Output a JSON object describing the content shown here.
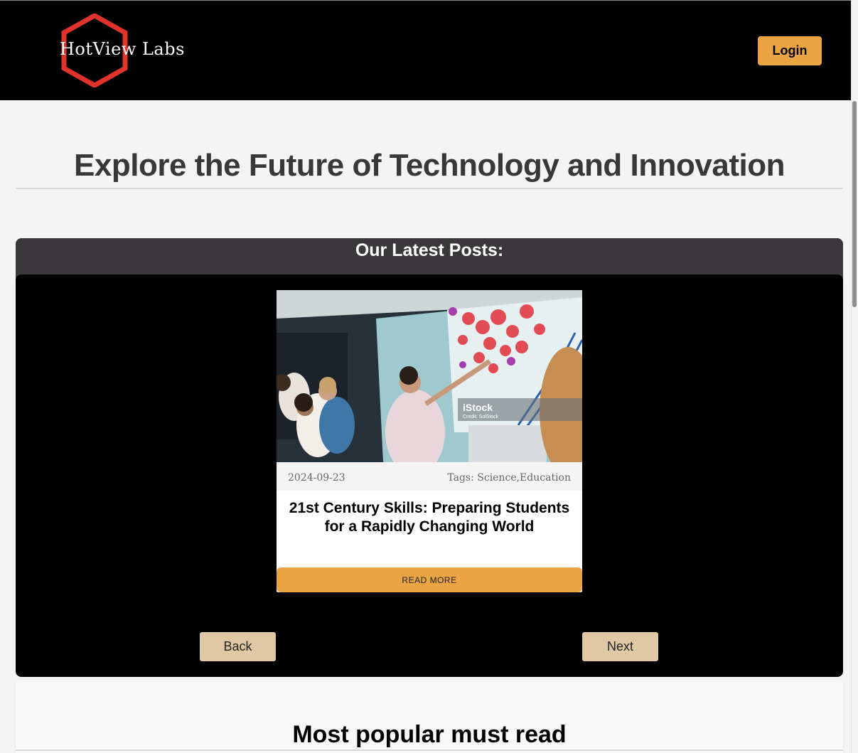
{
  "header": {
    "logo_text": "HotView Labs",
    "login_label": "Login"
  },
  "hero": {
    "title": "Explore the Future of Technology and Innovation"
  },
  "latest": {
    "title": "Our Latest Posts:",
    "post": {
      "date": "2024-09-23",
      "tags": "Tags: Science,Education",
      "title": "21st Century Skills: Preparing Students for a Rapidly Changing World",
      "read_more_label": "READ MORE",
      "image_watermark": "iStock",
      "image_credit": "Credit: SolStock"
    },
    "back_label": "Back",
    "next_label": "Next"
  },
  "popular": {
    "title": "Most popular must read"
  },
  "colors": {
    "accent": "#eba444",
    "nav_button": "#e0c8a5",
    "logo_hexagon": "#e0332b",
    "header_bg": "#000000"
  }
}
